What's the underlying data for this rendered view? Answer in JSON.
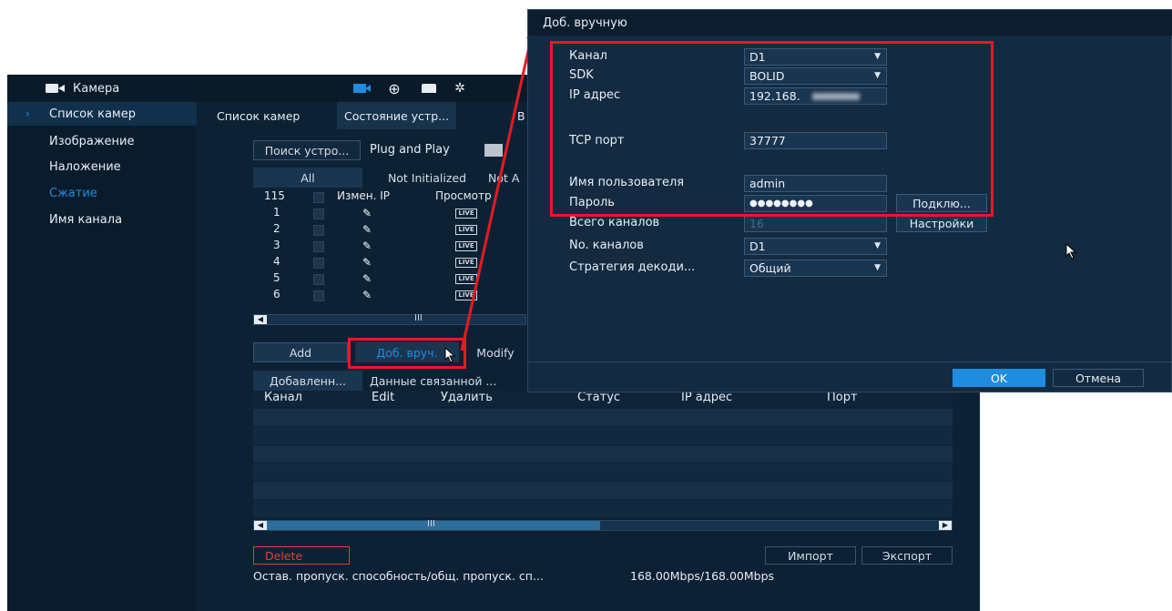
{
  "sidebar": {
    "header": "Камера",
    "items": [
      {
        "label": "Список камер"
      },
      {
        "label": "Изображение"
      },
      {
        "label": "Наложение"
      },
      {
        "label": "Сжатие"
      },
      {
        "label": "Имя канала"
      }
    ]
  },
  "tabs": [
    "Список камер",
    "Состояние устр...",
    "В"
  ],
  "toolbar": {
    "search_label": "Поиск устро...",
    "plug_play": "Plug and Play"
  },
  "filters": [
    "All",
    "Not Initialized",
    "Not A"
  ],
  "device_table": {
    "count": "115",
    "headers": [
      "Измен. IP",
      "Просмотр"
    ],
    "rows": [
      "1",
      "2",
      "3",
      "4",
      "5",
      "6"
    ],
    "live_label": "LIVE"
  },
  "actions": {
    "add": "Add",
    "manual_add": "Доб. вруч.",
    "modify": "Modify"
  },
  "added_tabs": [
    "Добавленн...",
    "Данные связанной ..."
  ],
  "added_table": {
    "headers": [
      "Канал",
      "Edit",
      "Удалить",
      "Статус",
      "IP адрес",
      "Порт"
    ]
  },
  "bottom": {
    "delete": "Delete",
    "import": "Импорт",
    "export": "Экспорт",
    "bandwidth_label": "Остав. пропуск. способность/общ. пропуск. сп...",
    "bandwidth_value": "168.00Mbps/168.00Mbps"
  },
  "dialog": {
    "title": "Доб. вручную",
    "fields": {
      "channel_label": "Канал",
      "channel_value": "D1",
      "sdk_label": "SDK",
      "sdk_value": "BOLID",
      "ip_label": "IP адрес",
      "ip_value": "192.168.",
      "tcp_label": "TCP порт",
      "tcp_value": "37777",
      "user_label": "Имя пользователя",
      "user_value": "admin",
      "pass_label": "Пароль",
      "pass_value": "●●●●●●●●",
      "total_label": "Всего каналов",
      "total_value": "16",
      "num_label": "No. каналов",
      "num_value": "D1",
      "strategy_label": "Стратегия декоди...",
      "strategy_value": "Общий"
    },
    "connect": "Подклю...",
    "settings": "Настройки",
    "ok": "OK",
    "cancel": "Отмена"
  },
  "colors": {
    "accent": "#1e8de0",
    "highlight": "#e31b23",
    "delete": "#e0403a"
  }
}
